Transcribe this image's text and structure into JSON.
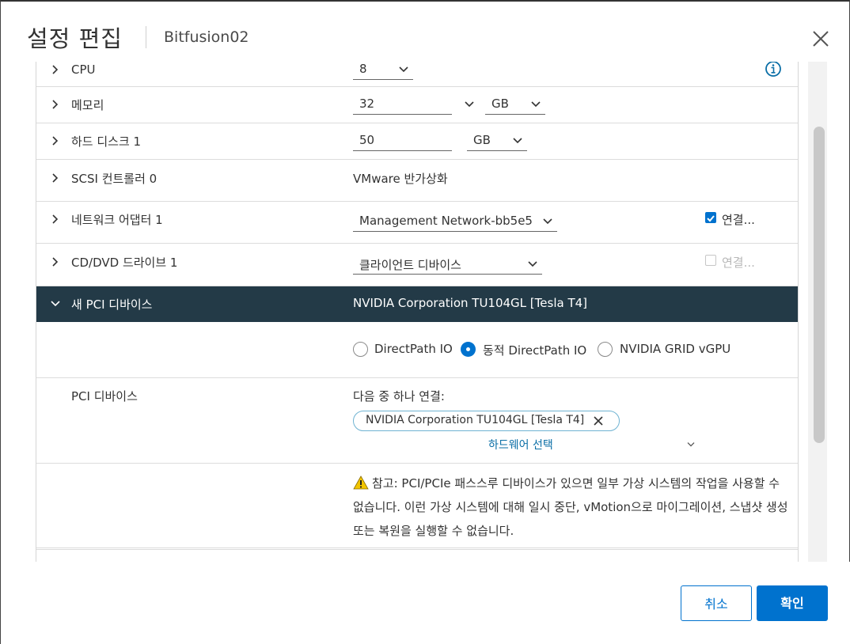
{
  "header": {
    "title": "설정 편집",
    "subtitle": "Bitfusion02"
  },
  "rows": {
    "cpu": {
      "label": "CPU",
      "value": "8"
    },
    "memory": {
      "label": "메모리",
      "value": "32",
      "unit": "GB"
    },
    "disk": {
      "label": "하드 디스크 1",
      "value": "50",
      "unit": "GB"
    },
    "scsi": {
      "label": "SCSI 컨트롤러 0",
      "value": "VMware 반가상화"
    },
    "network": {
      "label": "네트워크 어댑터 1",
      "value": "Management Network-bb5e5",
      "connect_label": "연결...",
      "connected": true
    },
    "cddvd": {
      "label": "CD/DVD 드라이브 1",
      "value": "클라이언트 디바이스",
      "connect_label": "연결...",
      "connected": false
    },
    "pci": {
      "label": "새 PCI 디바이스",
      "value": "NVIDIA Corporation TU104GL [Tesla T4]"
    }
  },
  "pci_options": {
    "modes": [
      {
        "label": "DirectPath IO",
        "selected": false
      },
      {
        "label": "동적 DirectPath IO",
        "selected": true
      },
      {
        "label": "NVIDIA GRID vGPU",
        "selected": false
      }
    ],
    "device_label": "PCI 디바이스",
    "connect_one_of": "다음 중 하나 연결:",
    "chip": "NVIDIA Corporation TU104GL [Tesla T4]",
    "select_hardware": "하드웨어 선택",
    "note": "참고: PCI/PCIe 패스스루 디바이스가 있으면 일부 가상 시스템의 작업을 사용할 수 없습니다. 이런 가상 시스템에 대해 일시 중단, vMotion으로 마이그레이션, 스냅샷 생성 또는 복원을 실행할 수 없습니다."
  },
  "footer": {
    "cancel": "취소",
    "ok": "확인"
  },
  "colors": {
    "accent": "#0072ce",
    "highlight_row": "#233a47",
    "warning": "#f2c500"
  }
}
